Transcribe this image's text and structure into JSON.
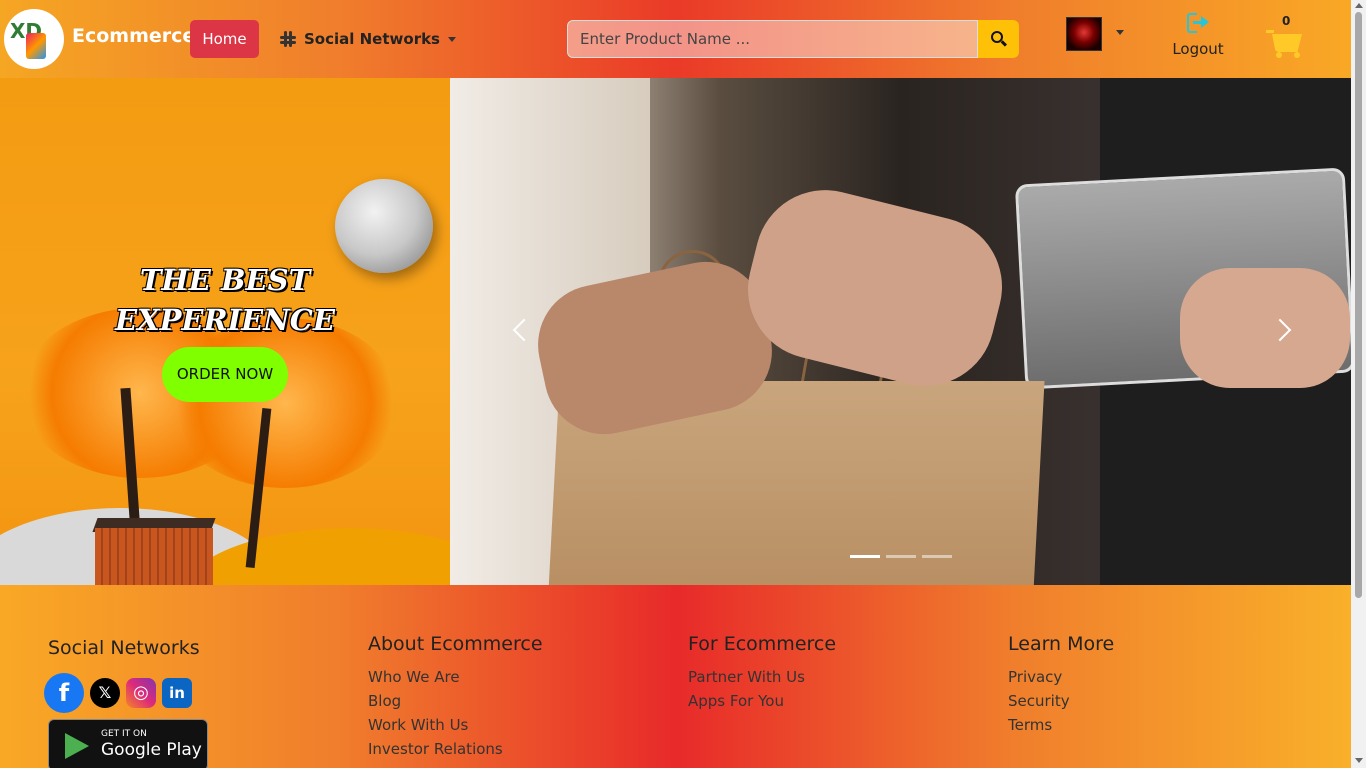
{
  "navbar": {
    "logo_text": "XD",
    "brand": "Ecommerce",
    "home_label": "Home",
    "social_dropdown_label": "Social Networks",
    "search": {
      "placeholder": "Enter Product Name ...",
      "value": ""
    },
    "logout_label": "Logout",
    "cart_count": "0",
    "icons": [
      "slack-icon",
      "search-icon",
      "avatar",
      "logout-icon",
      "cart-icon"
    ]
  },
  "hero": {
    "title_line1": "THE BEST",
    "title_line2": "EXPERIENCE",
    "order_button": "ORDER NOW",
    "carousel": {
      "slides": 3,
      "active_index": 0
    }
  },
  "footer": {
    "social": {
      "heading": "Social Networks",
      "icons": [
        "facebook-icon",
        "x-icon",
        "instagram-icon",
        "linkedin-icon"
      ],
      "fb_glyph": "f",
      "x_glyph": "𝕏",
      "ig_glyph": "◎",
      "li_glyph": "in"
    },
    "google_play": {
      "get_it_on": "GET IT ON",
      "store": "Google Play"
    },
    "about": {
      "heading": "About Ecommerce",
      "links": [
        "Who We Are",
        "Blog",
        "Work With Us",
        "Investor Relations"
      ]
    },
    "for_ecommerce": {
      "heading": "For Ecommerce",
      "links": [
        "Partner With Us",
        "Apps For You"
      ]
    },
    "learn_more": {
      "heading": "Learn More",
      "links": [
        "Privacy",
        "Security",
        "Terms"
      ]
    }
  },
  "colors": {
    "home_button": "#dc3545",
    "order_button": "#7fff00",
    "search_button": "#ffc107",
    "logout_icon": "#26c6da"
  }
}
